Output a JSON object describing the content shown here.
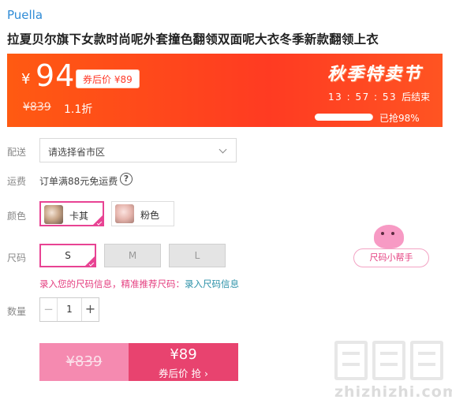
{
  "store": {
    "brand": "Puella"
  },
  "product": {
    "title": "拉夏贝尔旗下女款时尚呢外套撞色翻领双面呢大衣冬季新款翻领上衣"
  },
  "promo": {
    "currency": "¥",
    "price": "94",
    "coupon_price": "券后价 ¥89",
    "original_price": "¥839",
    "discount": "1.1折",
    "event_name": "秋季特卖节",
    "countdown": "13 : 57 : 53",
    "countdown_suffix": "后结束",
    "sold_percent": 0.98,
    "sold_text": "已抢98%",
    "colors": {
      "start": "#ff5a12",
      "end": "#ff3b22"
    }
  },
  "delivery": {
    "label": "配送",
    "placeholder": "请选择省市区"
  },
  "freight": {
    "label": "运费",
    "text": "订单满88元免运费",
    "help_icon": "question-circle-icon",
    "help_glyph": "?"
  },
  "color": {
    "label": "颜色",
    "options": [
      {
        "name": "卡其",
        "selected": true
      },
      {
        "name": "粉色",
        "selected": false
      }
    ]
  },
  "size": {
    "label": "尺码",
    "options": [
      {
        "name": "S",
        "selected": true,
        "available": true
      },
      {
        "name": "M",
        "selected": false,
        "available": false
      },
      {
        "name": "L",
        "selected": false,
        "available": false
      }
    ],
    "helper_label": "尺码小帮手",
    "hint_text": "录入您的尺码信息，精准推荐尺码：",
    "hint_link": "录入尺码信息"
  },
  "quantity": {
    "label": "数量",
    "value": "1",
    "minus": "−",
    "plus": "+"
  },
  "buy": {
    "original_price": "¥839",
    "coupon_price": "¥89",
    "coupon_action": "券后价 抢 ›"
  },
  "watermark": {
    "text": "zhizhizhi.com"
  },
  "accent_colors": {
    "pink": "#e84393",
    "buy": "#e8436f",
    "link": "#2b91a8",
    "brand": "#2f8bd6"
  }
}
